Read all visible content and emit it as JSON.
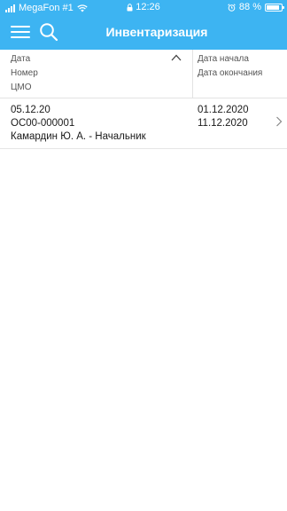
{
  "status_bar": {
    "carrier": "MegaFon #1",
    "time": "12:26",
    "battery_percent": "88 %",
    "battery_level": 0.88
  },
  "header": {
    "title": "Инвентаризация",
    "menu_icon": "hamburger-menu-icon",
    "search_icon": "search-icon"
  },
  "columns": {
    "left": [
      "Дата",
      "Номер",
      "ЦМО"
    ],
    "right": [
      "Дата начала",
      "Дата окончания"
    ],
    "sort_icon": "chevron-up-icon"
  },
  "rows": [
    {
      "date": "05.12.20",
      "number": "ОС00-000001",
      "cmo": "Камардин Ю. А. - Начальник",
      "start_date": "01.12.2020",
      "end_date": "11.12.2020"
    }
  ],
  "colors": {
    "accent": "#3db4f2",
    "header_text": "#ffffff",
    "separator": "#e2e2e2"
  }
}
